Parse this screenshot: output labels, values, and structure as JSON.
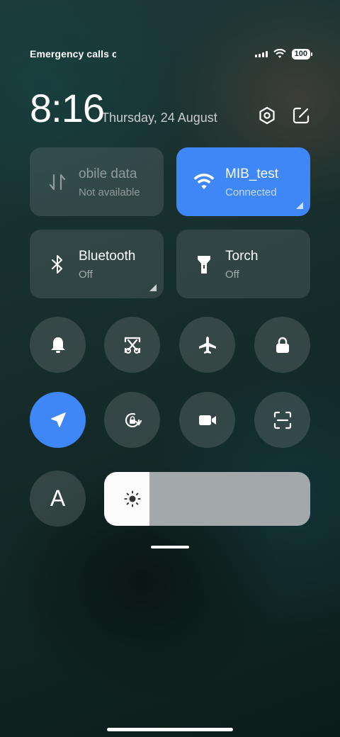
{
  "status_bar": {
    "carrier_text": "Emergency calls o",
    "battery_level": "100",
    "icons": [
      "signal-icon",
      "wifi-icon",
      "battery-icon"
    ]
  },
  "header": {
    "time": "8:16",
    "date": "Thursday, 24 August",
    "icons": [
      "settings-icon",
      "edit-icon"
    ]
  },
  "tiles": [
    {
      "id": "mobile-data",
      "title": "obile data",
      "subtitle": "Not available",
      "active": false,
      "icon": "data-arrows-icon"
    },
    {
      "id": "wifi",
      "title": "MIB_test",
      "subtitle": "Connected",
      "active": true,
      "icon": "wifi-icon"
    },
    {
      "id": "bluetooth",
      "title": "Bluetooth",
      "subtitle": "Off",
      "active": false,
      "icon": "bluetooth-icon"
    },
    {
      "id": "torch",
      "title": "Torch",
      "subtitle": "Off",
      "active": false,
      "icon": "torch-icon"
    }
  ],
  "toggles": [
    {
      "name": "bell-icon",
      "active": false
    },
    {
      "name": "screenshot-icon",
      "active": false
    },
    {
      "name": "airplane-icon",
      "active": false
    },
    {
      "name": "lock-icon",
      "active": false
    },
    {
      "name": "location-icon",
      "active": true
    },
    {
      "name": "rotation-lock-icon",
      "active": false
    },
    {
      "name": "video-camera-icon",
      "active": false
    },
    {
      "name": "scanner-icon",
      "active": false
    }
  ],
  "font_button": {
    "label": "A"
  },
  "brightness": {
    "level_fraction": 0.22,
    "icon": "sun-icon"
  },
  "colors": {
    "accent": "#3f86f6",
    "tile_bg": "rgba(120,130,132,0.28)"
  }
}
